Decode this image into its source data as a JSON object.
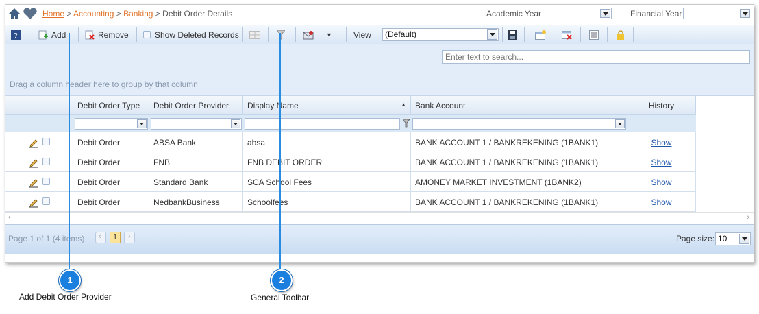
{
  "breadcrumb": {
    "home": "Home",
    "sep1": " > ",
    "accounting": "Accounting",
    "sep2": " > ",
    "banking": "Banking",
    "sep3": " > ",
    "current": "Debit Order Details"
  },
  "filters": {
    "academic_year_label": "Academic Year",
    "academic_year_value": "",
    "financial_year_label": "Financial Year",
    "financial_year_value": ""
  },
  "toolbar": {
    "add_label": "Add",
    "remove_label": "Remove",
    "show_deleted_label": "Show Deleted Records",
    "view_label": "View",
    "view_value": "(Default)"
  },
  "search": {
    "placeholder": "Enter text to search..."
  },
  "group_panel": {
    "hint": "Drag a column header here to group by that column"
  },
  "grid": {
    "columns": [
      "Debit Order Type",
      "Debit Order Provider",
      "Display Name",
      "Bank Account",
      "History"
    ],
    "sort_indicator": "▲",
    "rows": [
      {
        "type": "Debit Order",
        "provider": "ABSA Bank",
        "display": "absa",
        "account": "BANK ACCOUNT 1 / BANKREKENING (1BANK1)",
        "history": "Show"
      },
      {
        "type": "Debit Order",
        "provider": "FNB",
        "display": "FNB DEBIT ORDER",
        "account": "BANK ACCOUNT 1 / BANKREKENING (1BANK1)",
        "history": "Show"
      },
      {
        "type": "Debit Order",
        "provider": "Standard Bank",
        "display": "SCA School Fees",
        "account": "AMONEY MARKET INVESTMENT (1BANK2)",
        "history": "Show"
      },
      {
        "type": "Debit Order",
        "provider": "NedbankBusiness",
        "display": "Schoolfees",
        "account": "BANK ACCOUNT 1 / BANKREKENING (1BANK1)",
        "history": "Show"
      }
    ]
  },
  "pager": {
    "info": "Page 1 of 1 (4 items)",
    "current_page": "1",
    "page_size_label": "Page size:",
    "page_size_value": "10"
  },
  "callouts": [
    {
      "number": "1",
      "label": "Add Debit Order Provider"
    },
    {
      "number": "2",
      "label": "General Toolbar"
    }
  ],
  "colors": {
    "accent": "#e0742b",
    "badge": "#1a7fde",
    "header_bg": "#dde8f5"
  }
}
